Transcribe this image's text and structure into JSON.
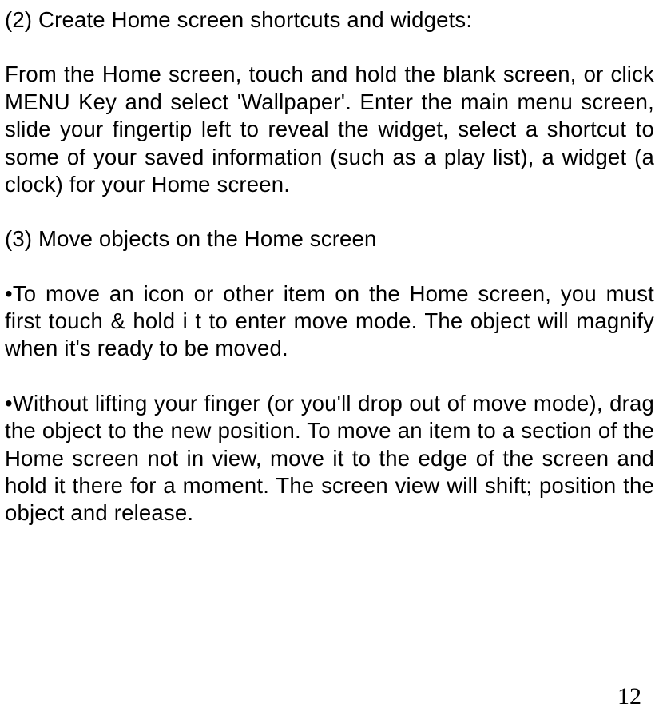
{
  "document": {
    "paragraphs": {
      "p1": "(2) Create Home screen shortcuts and widgets:",
      "p2": "From the Home screen, touch and hold the blank screen, or click MENU Key and select 'Wallpaper'. Enter the main menu screen, slide your fingertip left to reveal the widget, select a shortcut to some of your saved information (such as a play list), a widget (a clock) for your Home screen.",
      "p3": "(3) Move objects on the Home screen",
      "p4": "•To move an icon or other item on the Home screen, you must first touch & hold i t to enter move mode. The object will magnify when it's ready to be moved.",
      "p5": "•Without lifting your finger (or you'll drop out of move mode), drag the object to the new position. To move an item to a section of the Home screen not in view, move it to the edge of the screen and hold it there for a moment. The screen view will shift; position the object and release."
    },
    "page_number": "12"
  }
}
